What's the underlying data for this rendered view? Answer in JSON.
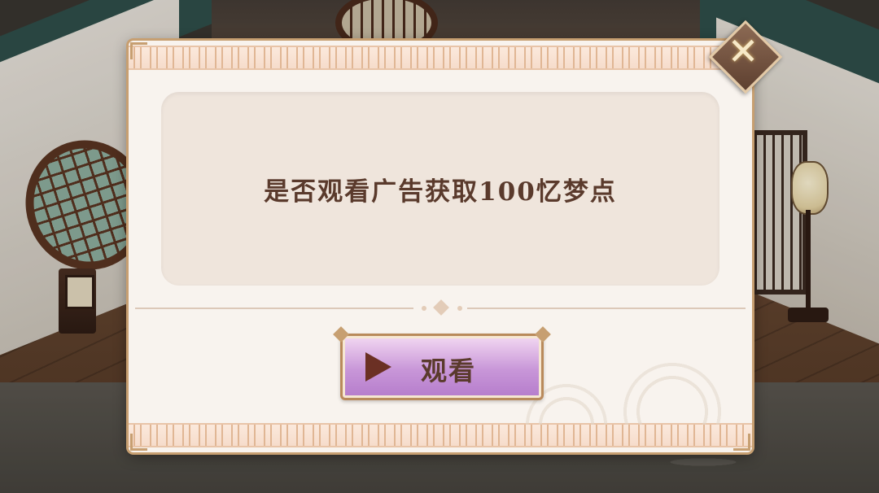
{
  "dialog": {
    "message": "是否观看广告获取100忆梦点",
    "watch_button_label": "观看",
    "close_icon": "close-icon",
    "play_icon": "play-icon"
  },
  "colors": {
    "dialog_background": "#f8f3ee",
    "panel_background": "#efe5dc",
    "text_brown": "#5a3a2c",
    "button_purple": "#c896d8",
    "border_gold": "#c79f71"
  }
}
